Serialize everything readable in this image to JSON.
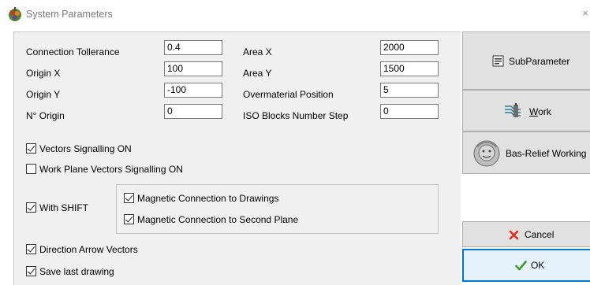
{
  "window": {
    "title": "System Parameters",
    "close_glyph": "×"
  },
  "fields": {
    "connection_tolerance": {
      "label": "Connection Tollerance",
      "value": "0.4"
    },
    "origin_x": {
      "label": "Origin X",
      "value": "100"
    },
    "origin_y": {
      "label": "Origin Y",
      "value": "-100"
    },
    "n_origin": {
      "label": "N° Origin",
      "value": "0"
    },
    "area_x": {
      "label": "Area X",
      "value": "2000"
    },
    "area_y": {
      "label": "Area Y",
      "value": "1500"
    },
    "overmaterial_position": {
      "label": "Overmaterial Position",
      "value": "5"
    },
    "iso_blocks_number_step": {
      "label": "ISO Blocks Number Step",
      "value": "0"
    }
  },
  "checkboxes": {
    "vectors_signalling": {
      "label": "Vectors Signalling ON",
      "checked": true
    },
    "work_plane_vectors": {
      "label": "Work Plane Vectors Signalling ON",
      "checked": false
    },
    "with_shift": {
      "label": "With SHIFT",
      "checked": true
    },
    "magnetic_drawings": {
      "label": "Magnetic Connection to Drawings",
      "checked": true
    },
    "magnetic_second_plane": {
      "label": "Magnetic Connection to Second Plane",
      "checked": true
    },
    "direction_arrow": {
      "label": "Direction Arrow Vectors",
      "checked": true
    },
    "save_last_drawing": {
      "label": "Save last drawing",
      "checked": true
    }
  },
  "buttons": {
    "subparameter": {
      "label": "SubParameter",
      "icon": "document-list-icon"
    },
    "work": {
      "label_first": "W",
      "label_rest": "ork",
      "icon": "machine-work-icon"
    },
    "bas_relief": {
      "label": "Bas-Relief Working",
      "icon": "bas-relief-face-icon"
    },
    "cancel": {
      "label": "Cancel",
      "icon": "red-x-icon"
    },
    "ok": {
      "label": "OK",
      "icon": "green-check-icon"
    }
  },
  "colors": {
    "accent": "#0078d7",
    "cancel_red": "#e0321e",
    "ok_green": "#3c9a2a"
  }
}
